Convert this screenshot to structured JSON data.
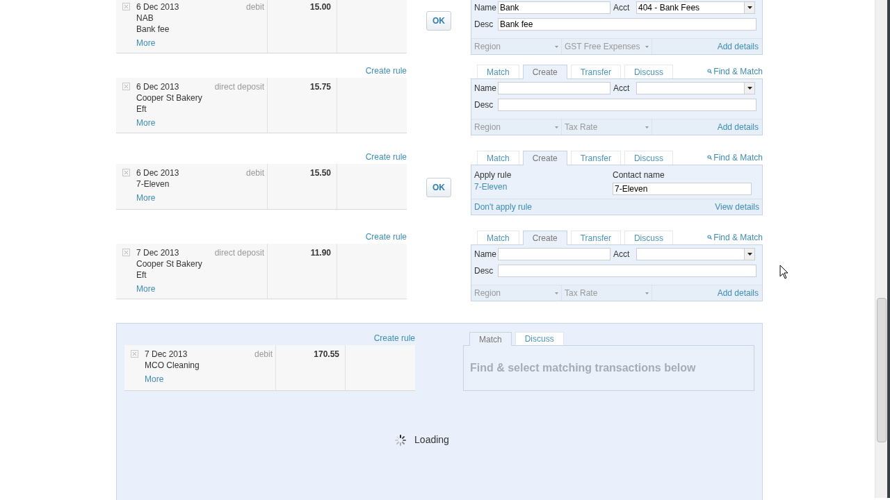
{
  "transactions": [
    {
      "date": "6 Dec 2013",
      "lines": [
        "NAB",
        "Bank fee"
      ],
      "more": "More",
      "type": "debit",
      "amount": "15.00",
      "ok": "OK",
      "panel": {
        "kind": "create",
        "name_label": "Name",
        "name_value": "Bank",
        "acct_label": "Acct",
        "acct_value": "404 - Bank Fees",
        "desc_label": "Desc",
        "desc_value": "Bank fee",
        "region": "Region",
        "tax": "GST Free Expenses",
        "details": "Add details"
      }
    },
    {
      "create_rule": "Create rule",
      "date": "6 Dec 2013",
      "lines": [
        "Cooper St Bakery",
        "Eft"
      ],
      "more": "More",
      "type": "direct deposit",
      "amount": "15.75",
      "tabs": [
        {
          "label": "Match",
          "selected": false
        },
        {
          "label": "Create",
          "selected": true
        },
        {
          "label": "Transfer",
          "selected": false
        },
        {
          "label": "Discuss",
          "selected": false
        }
      ],
      "find": "Find & Match",
      "panel": {
        "kind": "create",
        "name_label": "Name",
        "acct_label": "Acct",
        "desc_label": "Desc",
        "region": "Region",
        "tax": "Tax Rate",
        "details": "Add details"
      }
    },
    {
      "create_rule": "Create rule",
      "date": "6 Dec 2013",
      "lines": [
        "7-Eleven"
      ],
      "more": "More",
      "type": "debit",
      "amount": "15.50",
      "ok": "OK",
      "tabs": [
        {
          "label": "Match",
          "selected": false
        },
        {
          "label": "Create",
          "selected": true
        },
        {
          "label": "Transfer",
          "selected": false
        },
        {
          "label": "Discuss",
          "selected": false
        }
      ],
      "find": "Find & Match",
      "panel": {
        "kind": "rule",
        "rule_label": "Apply rule",
        "rule_link": "7-Eleven",
        "contact_label": "Contact name",
        "contact_value": "7-Eleven",
        "dont": "Don't apply rule",
        "details": "View details"
      }
    },
    {
      "create_rule": "Create rule",
      "date": "7 Dec 2013",
      "lines": [
        "Cooper St Bakery",
        "Eft"
      ],
      "more": "More",
      "type": "direct deposit",
      "amount": "11.90",
      "tabs": [
        {
          "label": "Match",
          "selected": false
        },
        {
          "label": "Create",
          "selected": true
        },
        {
          "label": "Transfer",
          "selected": false
        },
        {
          "label": "Discuss",
          "selected": false
        }
      ],
      "find": "Find & Match",
      "panel": {
        "kind": "create",
        "name_label": "Name",
        "acct_label": "Acct",
        "desc_label": "Desc",
        "region": "Region",
        "tax": "Tax Rate",
        "details": "Add details"
      }
    }
  ],
  "pending": {
    "create_rule": "Create rule",
    "date": "7 Dec 2013",
    "lines": [
      "MCO Cleaning"
    ],
    "more": "More",
    "type": "debit",
    "amount": "170.55",
    "tabs": [
      {
        "label": "Match",
        "selected": true
      },
      {
        "label": "Discuss",
        "selected": false
      }
    ],
    "message": "Find & select matching transactions below",
    "loading": "Loading"
  }
}
